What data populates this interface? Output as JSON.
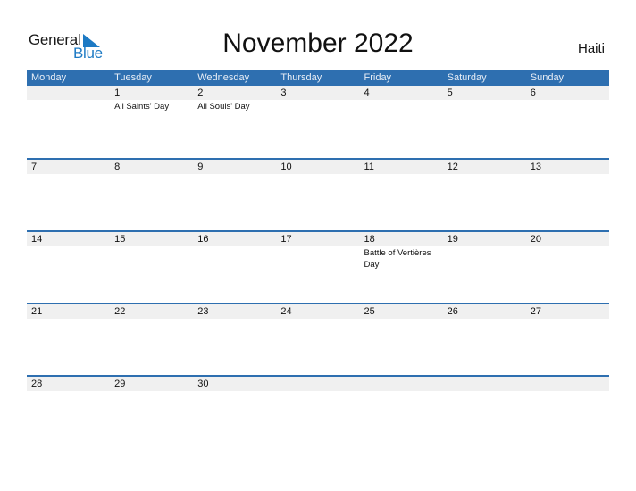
{
  "logo": {
    "line1": "General",
    "line2": "Blue",
    "accent": "#1d7ac4"
  },
  "title": "November 2022",
  "country": "Haiti",
  "colors": {
    "header_bg": "#2e6fb0",
    "row_strip": "#f0f0f0"
  },
  "weekdays": [
    "Monday",
    "Tuesday",
    "Wednesday",
    "Thursday",
    "Friday",
    "Saturday",
    "Sunday"
  ],
  "weeks": [
    {
      "days": [
        {
          "num": "",
          "holiday": ""
        },
        {
          "num": "1",
          "holiday": "All Saints' Day"
        },
        {
          "num": "2",
          "holiday": "All Souls' Day"
        },
        {
          "num": "3",
          "holiday": ""
        },
        {
          "num": "4",
          "holiday": ""
        },
        {
          "num": "5",
          "holiday": ""
        },
        {
          "num": "6",
          "holiday": ""
        }
      ]
    },
    {
      "days": [
        {
          "num": "7",
          "holiday": ""
        },
        {
          "num": "8",
          "holiday": ""
        },
        {
          "num": "9",
          "holiday": ""
        },
        {
          "num": "10",
          "holiday": ""
        },
        {
          "num": "11",
          "holiday": ""
        },
        {
          "num": "12",
          "holiday": ""
        },
        {
          "num": "13",
          "holiday": ""
        }
      ]
    },
    {
      "days": [
        {
          "num": "14",
          "holiday": ""
        },
        {
          "num": "15",
          "holiday": ""
        },
        {
          "num": "16",
          "holiday": ""
        },
        {
          "num": "17",
          "holiday": ""
        },
        {
          "num": "18",
          "holiday": "Battle of Vertières Day"
        },
        {
          "num": "19",
          "holiday": ""
        },
        {
          "num": "20",
          "holiday": ""
        }
      ]
    },
    {
      "days": [
        {
          "num": "21",
          "holiday": ""
        },
        {
          "num": "22",
          "holiday": ""
        },
        {
          "num": "23",
          "holiday": ""
        },
        {
          "num": "24",
          "holiday": ""
        },
        {
          "num": "25",
          "holiday": ""
        },
        {
          "num": "26",
          "holiday": ""
        },
        {
          "num": "27",
          "holiday": ""
        }
      ]
    },
    {
      "days": [
        {
          "num": "28",
          "holiday": ""
        },
        {
          "num": "29",
          "holiday": ""
        },
        {
          "num": "30",
          "holiday": ""
        },
        {
          "num": "",
          "holiday": ""
        },
        {
          "num": "",
          "holiday": ""
        },
        {
          "num": "",
          "holiday": ""
        },
        {
          "num": "",
          "holiday": ""
        }
      ]
    }
  ]
}
